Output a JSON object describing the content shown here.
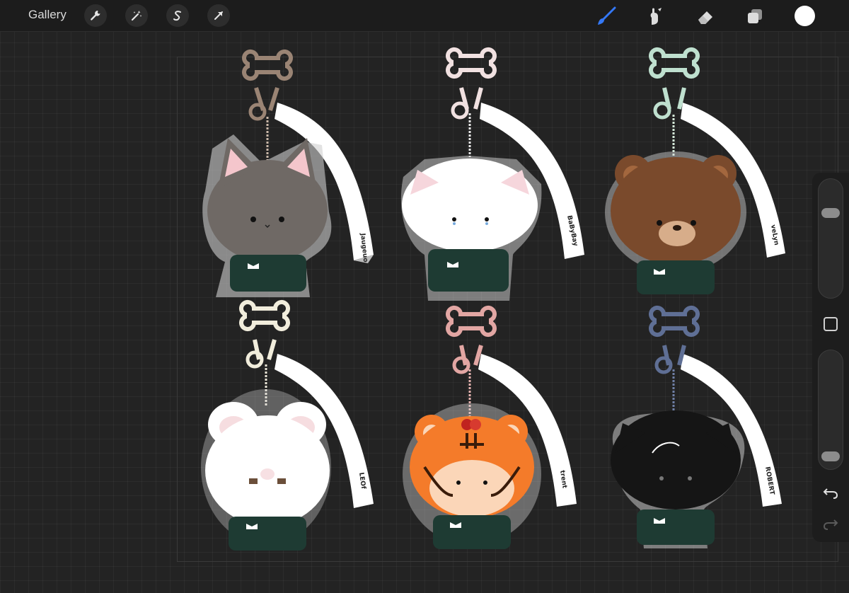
{
  "toolbar": {
    "gallery_label": "Gallery",
    "left_tools": [
      "actions-wrench-icon",
      "adjustments-wand-icon",
      "selection-s-icon",
      "transform-arrow-icon"
    ],
    "right_tools": [
      "brush-icon",
      "smudge-icon",
      "eraser-icon",
      "layers-icon"
    ],
    "active_tool": "brush-icon",
    "accent_color": "#3478f6",
    "current_color": "#ffffff"
  },
  "artwork": {
    "keychains": [
      {
        "character": "grey-tabby-cat",
        "strap_text": "Jaugeuo",
        "hanger_color": "#9a8474",
        "body_color": "#6f6965"
      },
      {
        "character": "white-cat",
        "strap_text": "BaByBay",
        "hanger_color": "#f1e1e1",
        "body_color": "#ffffff"
      },
      {
        "character": "brown-bear",
        "strap_text": "veLyn",
        "hanger_color": "#bfe0cf",
        "body_color": "#7a4a2c"
      },
      {
        "character": "white-bunny",
        "strap_text": "LEOf",
        "hanger_color": "#f1eddc",
        "body_color": "#ffffff"
      },
      {
        "character": "orange-tiger",
        "strap_text": "trent",
        "hanger_color": "#e2a6a3",
        "body_color": "#f47b2a"
      },
      {
        "character": "black-cat",
        "strap_text": "ROBERT",
        "hanger_color": "#5f6f95",
        "body_color": "#151515"
      }
    ],
    "shirt_color": "#1e3b33"
  },
  "sidebar": {
    "brush_size_level": 0.75,
    "opacity_level": 0.05,
    "modify_label": "modify-square",
    "undo_icon": "undo-icon",
    "redo_icon": "redo-icon"
  }
}
